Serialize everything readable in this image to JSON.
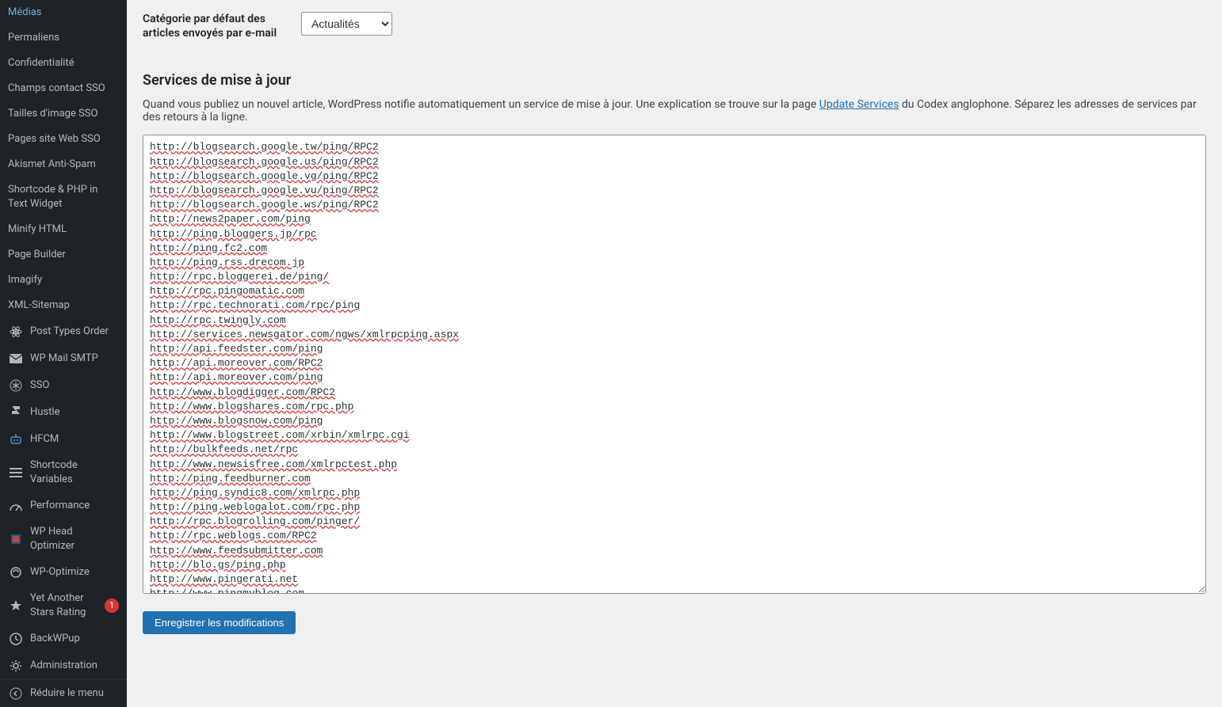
{
  "sidebar": {
    "items": [
      {
        "label": "Médias",
        "icon": null
      },
      {
        "label": "Permaliens",
        "icon": null
      },
      {
        "label": "Confidentialité",
        "icon": null
      },
      {
        "label": "Champs contact SSO",
        "icon": null
      },
      {
        "label": "Tailles d'image SSO",
        "icon": null
      },
      {
        "label": "Pages site Web SSO",
        "icon": null
      },
      {
        "label": "Akismet Anti-Spam",
        "icon": null
      },
      {
        "label": "Shortcode & PHP in Text Widget",
        "icon": null
      },
      {
        "label": "Minify HTML",
        "icon": null
      },
      {
        "label": "Page Builder",
        "icon": null
      },
      {
        "label": "Imagify",
        "icon": null
      },
      {
        "label": "XML-Sitemap",
        "icon": null
      },
      {
        "label": "Post Types Order",
        "icon": "atom"
      },
      {
        "label": "WP Mail SMTP",
        "icon": "mail"
      },
      {
        "label": "SSO",
        "icon": "asterisk"
      },
      {
        "label": "Hustle",
        "icon": "hustle"
      },
      {
        "label": "HFCM",
        "icon": "robot"
      },
      {
        "label": "Shortcode Variables",
        "icon": "list"
      },
      {
        "label": "Performance",
        "icon": "gauge"
      },
      {
        "label": "WP Head Optimizer",
        "icon": "wp-head"
      },
      {
        "label": "WP-Optimize",
        "icon": "optimize"
      },
      {
        "label": "Yet Another Stars Rating",
        "icon": "star",
        "badge": "1"
      },
      {
        "label": "BackWPup",
        "icon": "backup"
      },
      {
        "label": "Administration",
        "icon": "gear"
      }
    ],
    "collapse_label": "Réduire le menu"
  },
  "form": {
    "category_label": "Catégorie par défaut des articles envoyés par e-mail",
    "category_value": "Actualités"
  },
  "section": {
    "title": "Services de mise à jour",
    "desc_prefix": "Quand vous publiez un nouvel article, WordPress notifie automatiquement un service de mise à jour. Une explication se trouve sur la page ",
    "desc_link": "Update Services",
    "desc_suffix": " du Codex anglophone. Séparez les adresses de services par des retours à la ligne."
  },
  "services": "http://blogsearch.google.tw/ping/RPC2\nhttp://blogsearch.google.us/ping/RPC2\nhttp://blogsearch.google.vg/ping/RPC2\nhttp://blogsearch.google.vu/ping/RPC2\nhttp://blogsearch.google.ws/ping/RPC2\nhttp://news2paper.com/ping\nhttp://ping.bloggers.jp/rpc\nhttp://ping.fc2.com\nhttp://ping.rss.drecom.jp\nhttp://rpc.bloggerei.de/ping/\nhttp://rpc.pingomatic.com\nhttp://rpc.technorati.com/rpc/ping\nhttp://rpc.twingly.com\nhttp://services.newsgator.com/ngws/xmlrpcping.aspx\nhttp://api.feedster.com/ping\nhttp://api.moreover.com/RPC2\nhttp://api.moreover.com/ping\nhttp://www.blogdigger.com/RPC2\nhttp://www.blogshares.com/rpc.php\nhttp://www.blogsnow.com/ping\nhttp://www.blogstreet.com/xrbin/xmlrpc.cgi\nhttp://bulkfeeds.net/rpc\nhttp://www.newsisfree.com/xmlrpctest.php\nhttp://ping.feedburner.com\nhttp://ping.syndic8.com/xmlrpc.php\nhttp://ping.weblogalot.com/rpc.php\nhttp://rpc.blogrolling.com/pinger/\nhttp://rpc.weblogs.com/RPC2\nhttp://www.feedsubmitter.com\nhttp://blo.gs/ping.php\nhttp://www.pingerati.net\nhttp://www.pingmyblog.com",
  "submit_label": "Enregistrer les modifications"
}
